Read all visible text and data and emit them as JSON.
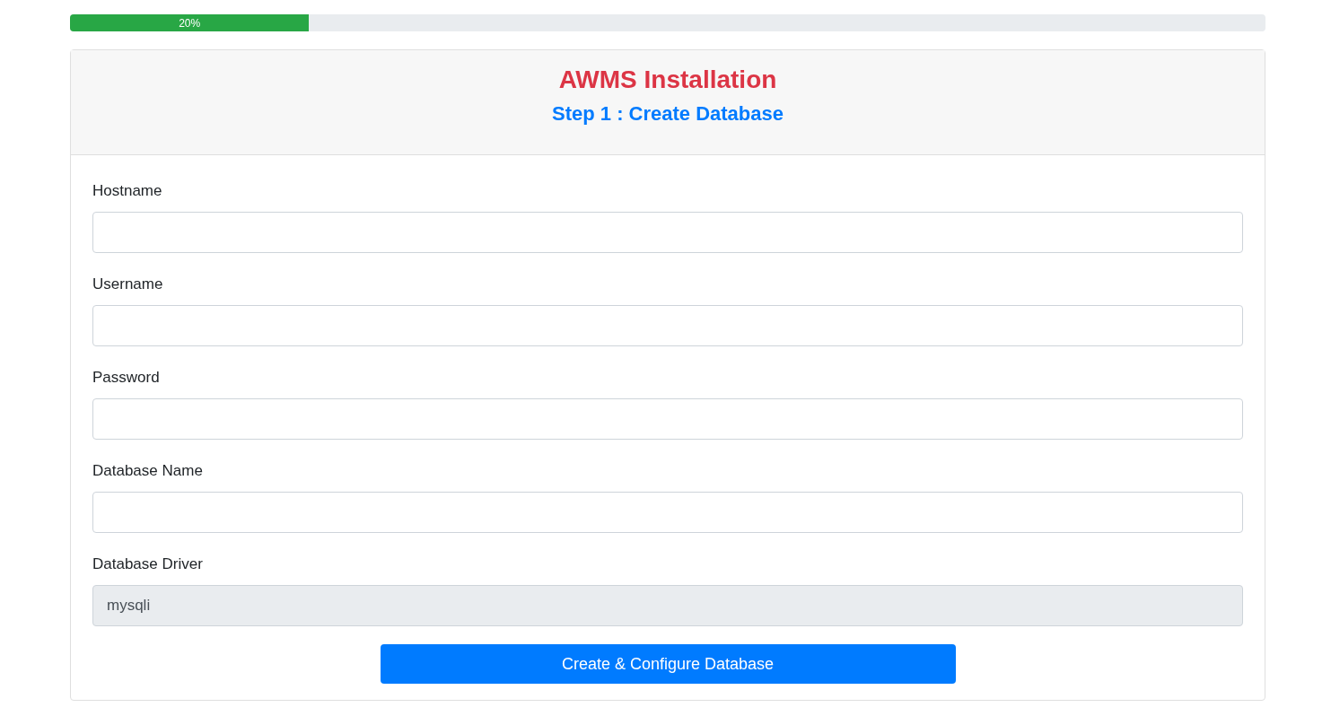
{
  "progress": {
    "label": "20%",
    "level": 0.2
  },
  "header": {
    "title": "AWMS Installation",
    "subtitle": "Step 1 : Create Database"
  },
  "fields": [
    {
      "label": "Hostname",
      "disabled": false
    },
    {
      "label": "Username",
      "disabled": false
    },
    {
      "label": "Password",
      "disabled": false
    },
    {
      "label": "Database Name",
      "disabled": false
    },
    {
      "label": "Database Driver",
      "value": "mysqli",
      "disabled": true
    }
  ],
  "submit_button": {
    "label": "Create & Configure Database"
  }
}
